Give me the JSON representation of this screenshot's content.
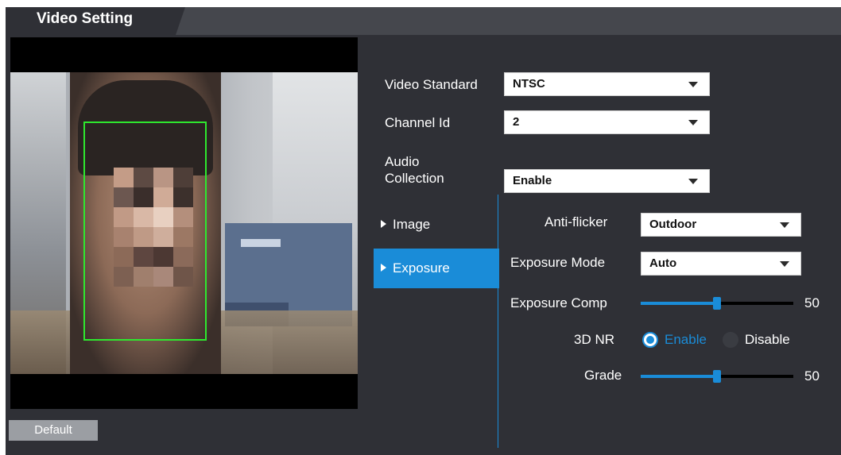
{
  "header": {
    "tab_title": "Video Setting"
  },
  "fields": {
    "video_standard": {
      "label": "Video Standard",
      "value": "NTSC"
    },
    "channel_id": {
      "label": "Channel Id",
      "value": "2"
    },
    "audio_collection": {
      "label_line1": "Audio",
      "label_line2": "Collection",
      "value": "Enable"
    }
  },
  "nav": {
    "items": [
      {
        "label": "Image",
        "selected": false
      },
      {
        "label": "Exposure",
        "selected": true
      }
    ]
  },
  "exposure": {
    "anti_flicker": {
      "label": "Anti-flicker",
      "value": "Outdoor"
    },
    "exposure_mode": {
      "label": "Exposure Mode",
      "value": "Auto"
    },
    "exposure_comp": {
      "label": "Exposure Comp",
      "value": "50",
      "level_fraction": 0.5
    },
    "nr_3d": {
      "label": "3D NR",
      "options": [
        "Enable",
        "Disable"
      ],
      "selected": "Enable"
    },
    "grade": {
      "label": "Grade",
      "value": "50",
      "level_fraction": 0.5
    }
  },
  "buttons": {
    "default_label": "Default"
  },
  "colors": {
    "accent": "#1a8cd8",
    "panel": "#2f3036",
    "header": "#45474d",
    "face_box": "#2ee82e"
  }
}
